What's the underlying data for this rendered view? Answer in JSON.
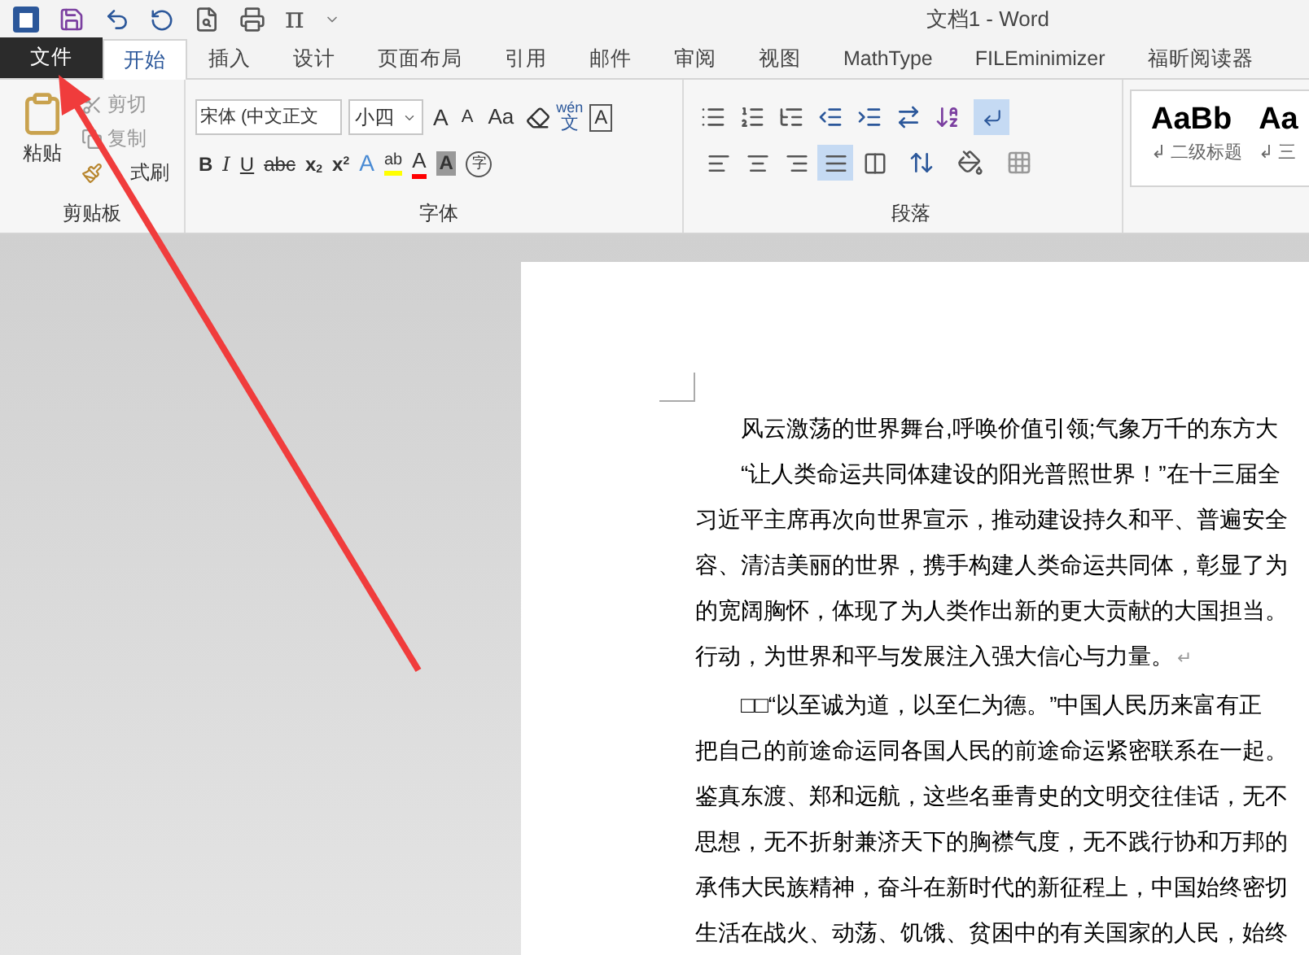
{
  "title_bar": {
    "equation_symbol": "π",
    "title": "文档1 - Word"
  },
  "tabs": [
    {
      "label": "文件",
      "kind": "file",
      "selected": false
    },
    {
      "label": "开始",
      "kind": "tab",
      "selected": true
    },
    {
      "label": "插入",
      "kind": "tab",
      "selected": false
    },
    {
      "label": "设计",
      "kind": "tab",
      "selected": false
    },
    {
      "label": "页面布局",
      "kind": "tab",
      "selected": false
    },
    {
      "label": "引用",
      "kind": "tab",
      "selected": false
    },
    {
      "label": "邮件",
      "kind": "tab",
      "selected": false
    },
    {
      "label": "审阅",
      "kind": "tab",
      "selected": false
    },
    {
      "label": "视图",
      "kind": "tab",
      "selected": false
    },
    {
      "label": "MathType",
      "kind": "tab",
      "selected": false
    },
    {
      "label": "FILEminimizer",
      "kind": "tab",
      "selected": false
    },
    {
      "label": "福昕阅读器",
      "kind": "tab",
      "selected": false
    }
  ],
  "clipboard": {
    "paste": "粘贴",
    "cut": "剪切",
    "copy": "复制",
    "format_painter": "式刷",
    "label": "剪贴板"
  },
  "font": {
    "font_name": "宋体 (中文正文",
    "font_size": "小四",
    "change_case": "Aa",
    "grow_font": "A",
    "shrink_font": "A",
    "phonetic_top": "wén",
    "phonetic_bottom": "文",
    "border_char": "A",
    "enclose_char": "字",
    "format_buttons": [
      {
        "label": "B",
        "kind": "bold"
      },
      {
        "label": "I",
        "kind": "italic"
      },
      {
        "label": "U",
        "kind": "underline"
      },
      {
        "label": "abc",
        "kind": "strike"
      },
      {
        "label": "x",
        "kind": "sub",
        "script": "2"
      },
      {
        "label": "x",
        "kind": "sup",
        "script": "2"
      }
    ],
    "effect_buttons": [
      {
        "label": "A",
        "kind": "effect"
      },
      {
        "label": "ab",
        "kind": "highlight"
      },
      {
        "label": "A",
        "kind": "color"
      },
      {
        "label": "A",
        "kind": "shade"
      }
    ],
    "label": "字体"
  },
  "paragraph": {
    "alignment": [
      {
        "kind": "left",
        "selected": false
      },
      {
        "kind": "center",
        "selected": false
      },
      {
        "kind": "right",
        "selected": false
      },
      {
        "kind": "justify",
        "selected": true
      },
      {
        "kind": "distributed",
        "selected": false
      }
    ],
    "show_marks": {
      "on": true
    },
    "label": "段落"
  },
  "styles": [
    {
      "preview": "AaBb",
      "mark": "↲",
      "name": "二级标题"
    },
    {
      "preview": "Aa",
      "mark": "↲",
      "name": "三"
    }
  ],
  "document": {
    "lines": [
      {
        "text": "风云激荡的世界舞台,呼唤价值引领;气象万千的东方大",
        "indent": true
      },
      {
        "text": "“让人类命运共同体建设的阳光普照世界！”在十三届全",
        "indent": true
      },
      {
        "text": "习近平主席再次向世界宣示，推动建设持久和平、普遍安全",
        "indent": false
      },
      {
        "text": "容、清洁美丽的世界，携手构建人类命运共同体，彰显了为",
        "indent": false
      },
      {
        "text": "的宽阔胸怀，体现了为人类作出新的更大贡献的大国担当。",
        "indent": false
      },
      {
        "text": "行动，为世界和平与发展注入强大信心与力量。",
        "indent": false,
        "end_mark": "↵"
      },
      {
        "text": "□□“以至诚为道，以至仁为德。”中国人民历来富有正",
        "indent": true
      },
      {
        "text": "把自己的前途命运同各国人民的前途命运紧密联系在一起。",
        "indent": false
      },
      {
        "text": "鉴真东渡、郑和远航，这些名垂青史的文明交往佳话，无不",
        "indent": false
      },
      {
        "text": "思想，无不折射兼济天下的胸襟气度，无不践行协和万邦的",
        "indent": false
      },
      {
        "text": "承伟大民族精神，奋斗在新时代的新征程上，中国始终密切",
        "indent": false
      },
      {
        "text": "生活在战火、动荡、饥饿、贫困中的有关国家的人民，始终",
        "indent": false
      }
    ]
  }
}
